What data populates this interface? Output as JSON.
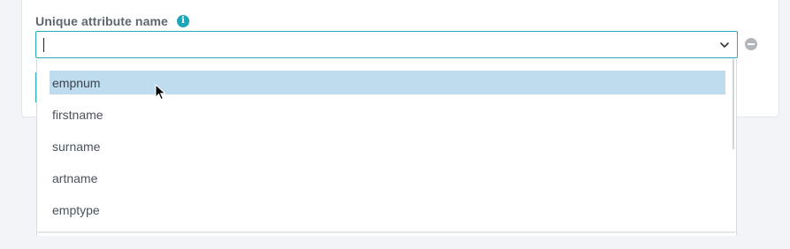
{
  "field": {
    "label": "Unique attribute name",
    "input_value": "",
    "info_icon": "info-icon",
    "chevron_icon": "chevron-down-icon",
    "remove_icon": "minus-circle-icon"
  },
  "dropdown": {
    "options": [
      {
        "label": "empnum",
        "highlighted": true
      },
      {
        "label": "firstname",
        "highlighted": false
      },
      {
        "label": "surname",
        "highlighted": false
      },
      {
        "label": "artname",
        "highlighted": false
      },
      {
        "label": "emptype",
        "highlighted": false
      }
    ]
  },
  "colors": {
    "accent": "#2aa7b7",
    "info_badge": "#1fa5b8",
    "highlight": "#bfdcee",
    "label_text": "#5d6670",
    "option_text": "#4a525a",
    "background": "#f3f4f7"
  }
}
